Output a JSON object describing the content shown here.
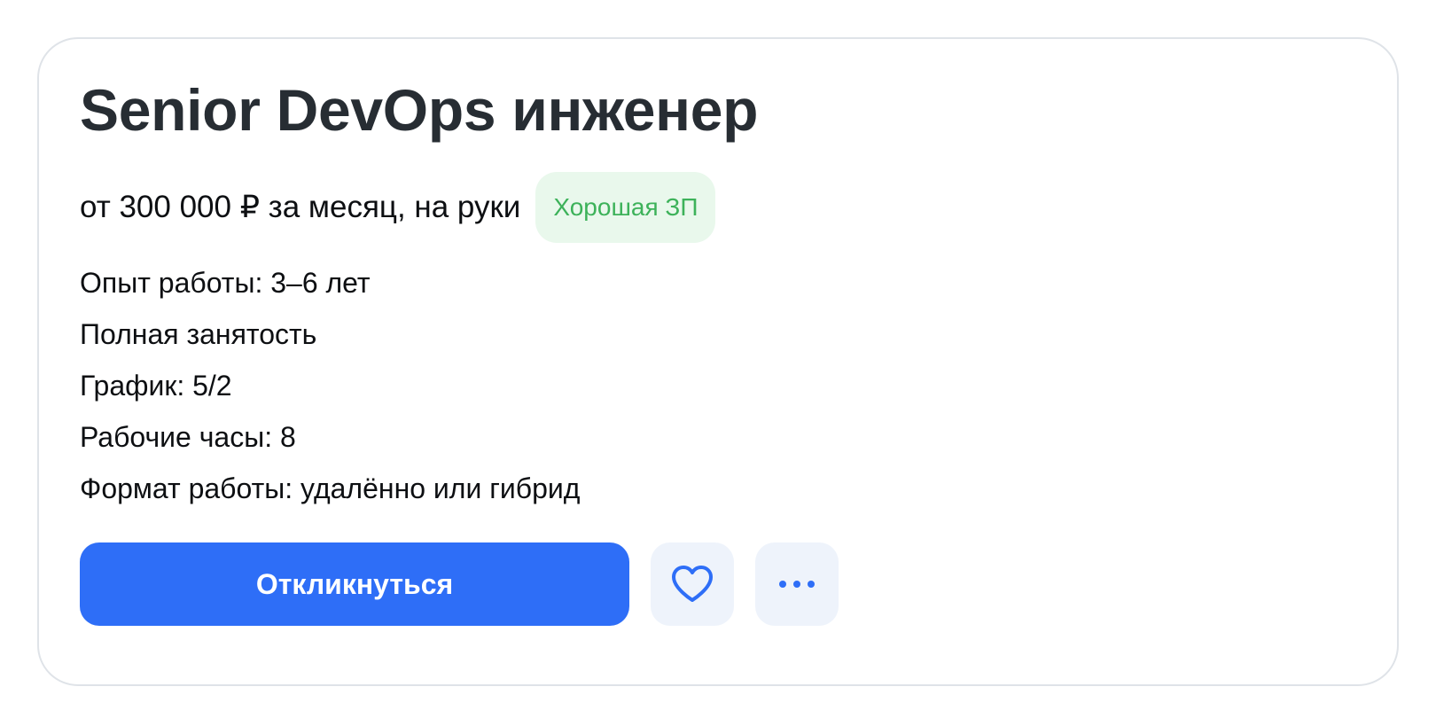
{
  "vacancy": {
    "title": "Senior DevOps инженер",
    "salary": "от 300 000 ₽ за месяц, на руки",
    "salary_badge": "Хорошая ЗП",
    "details": [
      "Опыт работы: 3–6 лет",
      "Полная занятость",
      "График: 5/2",
      "Рабочие часы: 8",
      "Формат работы: удалённо или гибрид"
    ]
  },
  "actions": {
    "apply_label": "Откликнуться",
    "favorite_icon": "heart-icon",
    "more_icon": "more-horizontal-icon"
  },
  "colors": {
    "accent": "#2e6ef7",
    "badge_text": "#3db25a",
    "badge_background": "#e9f8ec",
    "secondary_button_background": "#eef3fb",
    "title_text": "#272d33"
  }
}
